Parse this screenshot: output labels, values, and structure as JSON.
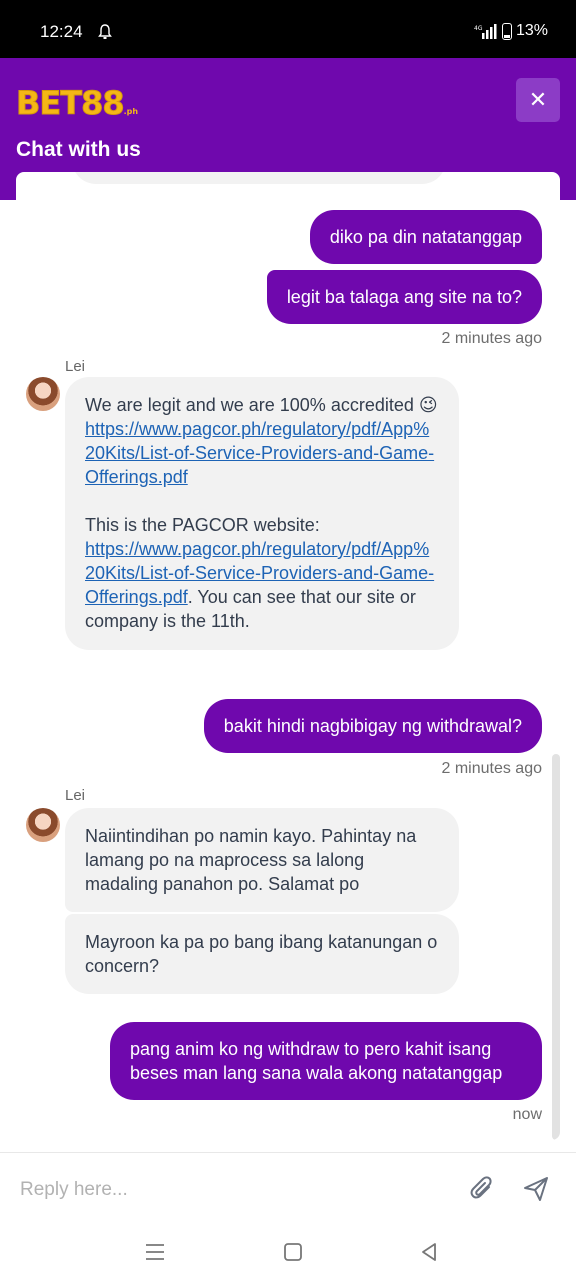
{
  "status_bar": {
    "time": "12:24",
    "network": "4G",
    "battery": "13%"
  },
  "header": {
    "logo": "BET88",
    "logo_suffix": ".ph",
    "close_glyph": "✕",
    "title": "Chat with us"
  },
  "messages": {
    "user_1": "diko pa din natatanggap",
    "user_2": "legit ba talaga ang site na to?",
    "ts_1": "2 minutes ago",
    "agent_name_1": "Lei",
    "agent_1": {
      "intro": "We are legit and we are 100% accredited 😉",
      "link_1": "https://www.pagcor.ph/regulatory/pdf/App%20Kits/List-of-Service-Providers-and-Game-Offerings.pdf",
      "website_label": "This is the PAGCOR website:",
      "link_2": "https://www.pagcor.ph/regulatory/pdf/App%20Kits/List-of-Service-Providers-and-Game-Offerings.pdf",
      "outro": ". You can see that our site or company is the 11th."
    },
    "user_3": "bakit hindi nagbibigay ng withdrawal?",
    "ts_2": "2 minutes ago",
    "agent_name_2": "Lei",
    "agent_2": "Naiintindihan po namin kayo. Pahintay na lamang po na maprocess sa lalong madaling panahon po. Salamat po",
    "agent_3": "Mayroon ka pa po bang ibang katanungan o concern?",
    "user_4": "pang anim ko ng withdraw to pero kahit isang beses man lang sana wala akong natatanggap",
    "ts_3": "now"
  },
  "composer": {
    "placeholder": "Reply here...",
    "attach_icon": "paperclip-icon",
    "send_icon": "send-icon"
  },
  "colors": {
    "brand_purple": "#6f08ad",
    "logo_gold": "#f5b716",
    "link_blue": "#1d63b5"
  }
}
